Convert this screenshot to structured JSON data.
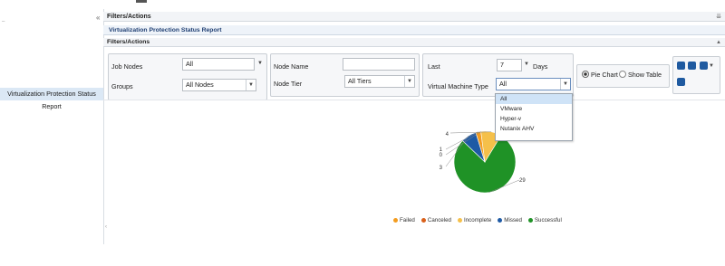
{
  "sidebar": {
    "selected_item": "Virtualization Protection Status Report"
  },
  "header": {
    "filters_actions_title": "Filters/Actions",
    "report_title": "Virtualization Protection Status Report",
    "filters_section_title": "Filters/Actions"
  },
  "filters": {
    "job_nodes_label": "Job Nodes",
    "job_nodes_value": "All",
    "groups_label": "Groups",
    "groups_value": "All Nodes",
    "node_name_label": "Node Name",
    "node_name_value": "",
    "node_tier_label": "Node Tier",
    "node_tier_value": "All Tiers",
    "last_label": "Last",
    "last_value": "7",
    "days_label": "Days",
    "vm_type_label": "Virtual Machine Type",
    "vm_type_value": "All",
    "vm_type_options": [
      "All",
      "VMware",
      "Hyper-v",
      "Nutanix AHV"
    ],
    "view_pie_label": "Pie Chart",
    "view_table_label": "Show Table",
    "view_selected": "Pie Chart"
  },
  "chart_data": {
    "type": "pie",
    "categories": [
      "Failed",
      "Canceled",
      "Incomplete",
      "Missed",
      "Successful"
    ],
    "values": [
      1,
      0,
      4,
      3,
      29
    ],
    "colors": [
      "#f39c1f",
      "#d9601a",
      "#f5c04a",
      "#1e5aa5",
      "#1f9226"
    ],
    "legend_position": "bottom"
  },
  "colors": {
    "accent": "#1f3f73",
    "selected_bg": "#dbe8f5"
  }
}
